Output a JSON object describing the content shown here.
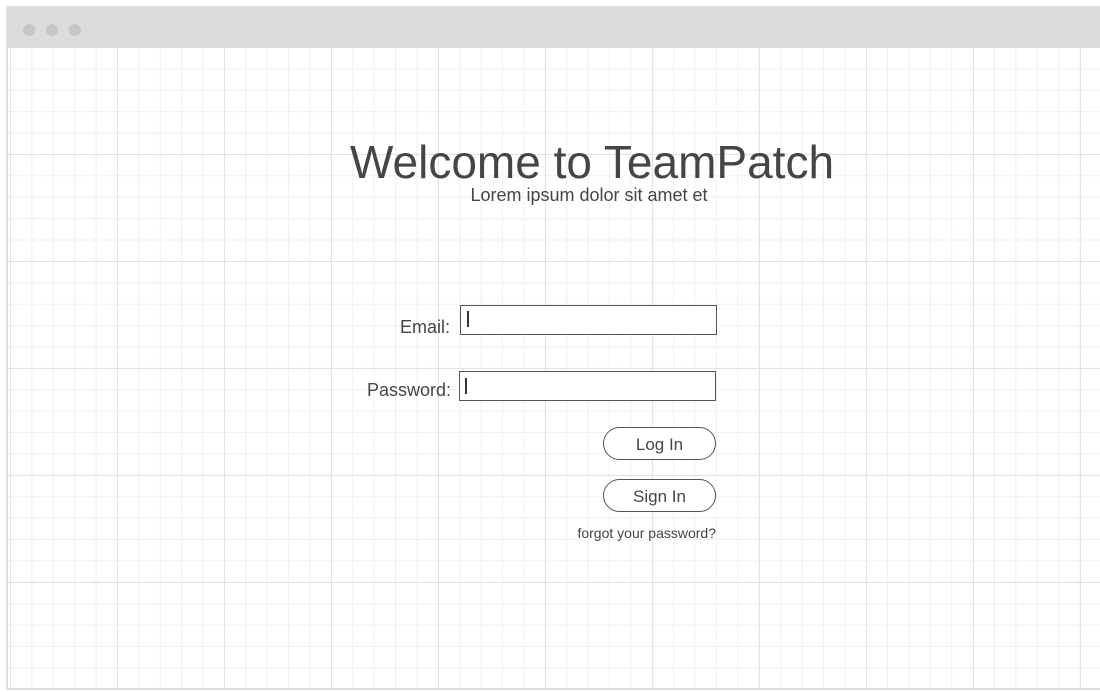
{
  "window": {
    "controls": [
      "window-dot",
      "window-dot",
      "window-dot"
    ]
  },
  "header": {
    "title": "Welcome to TeamPatch",
    "subtitle": "Lorem ipsum dolor sit amet et"
  },
  "form": {
    "email_label": "Email:",
    "email_value": "",
    "password_label": "Password:",
    "password_value": "",
    "login_label": "Log In",
    "signin_label": "Sign In",
    "forgot_label": "forgot your password?"
  },
  "colors": {
    "text": "#454545",
    "titlebar": "#dcdcdc",
    "grid_major": "#e2e2e2",
    "grid_minor": "#f0f0f0",
    "border": "#555555"
  }
}
